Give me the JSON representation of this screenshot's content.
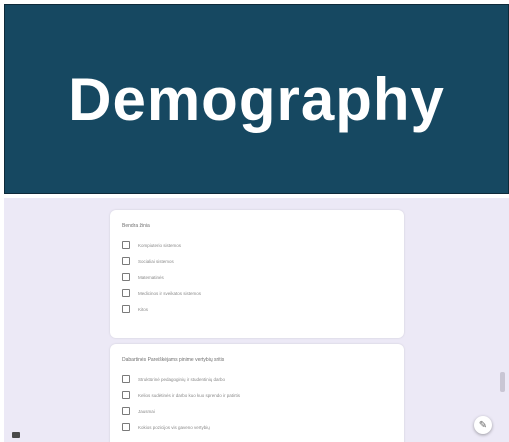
{
  "banner": {
    "title": "Demography"
  },
  "questions": [
    {
      "label": "Bendra žinia",
      "options": [
        "Kompiuterio sistemos",
        "Socialiai sistemos",
        "Matematinės",
        "Medicinos ir sveikatos sistemos",
        "Kitos"
      ]
    },
    {
      "label": "Dabartinės Pareiškėjams pinime vertybių sritis",
      "options": [
        "Struktūrinė pedagoginių ir studentinių darbo",
        "Kelios sudėtinės ir darbo kuo kuo sprendo ir patirtis",
        "Jausmai",
        "Kokios pozicijos vis gaveno vertybių"
      ]
    }
  ],
  "icons": {
    "edit": "pencil-icon",
    "left": "panel-icon"
  },
  "colors": {
    "banner": "#164861",
    "background": "#ece9f6"
  }
}
